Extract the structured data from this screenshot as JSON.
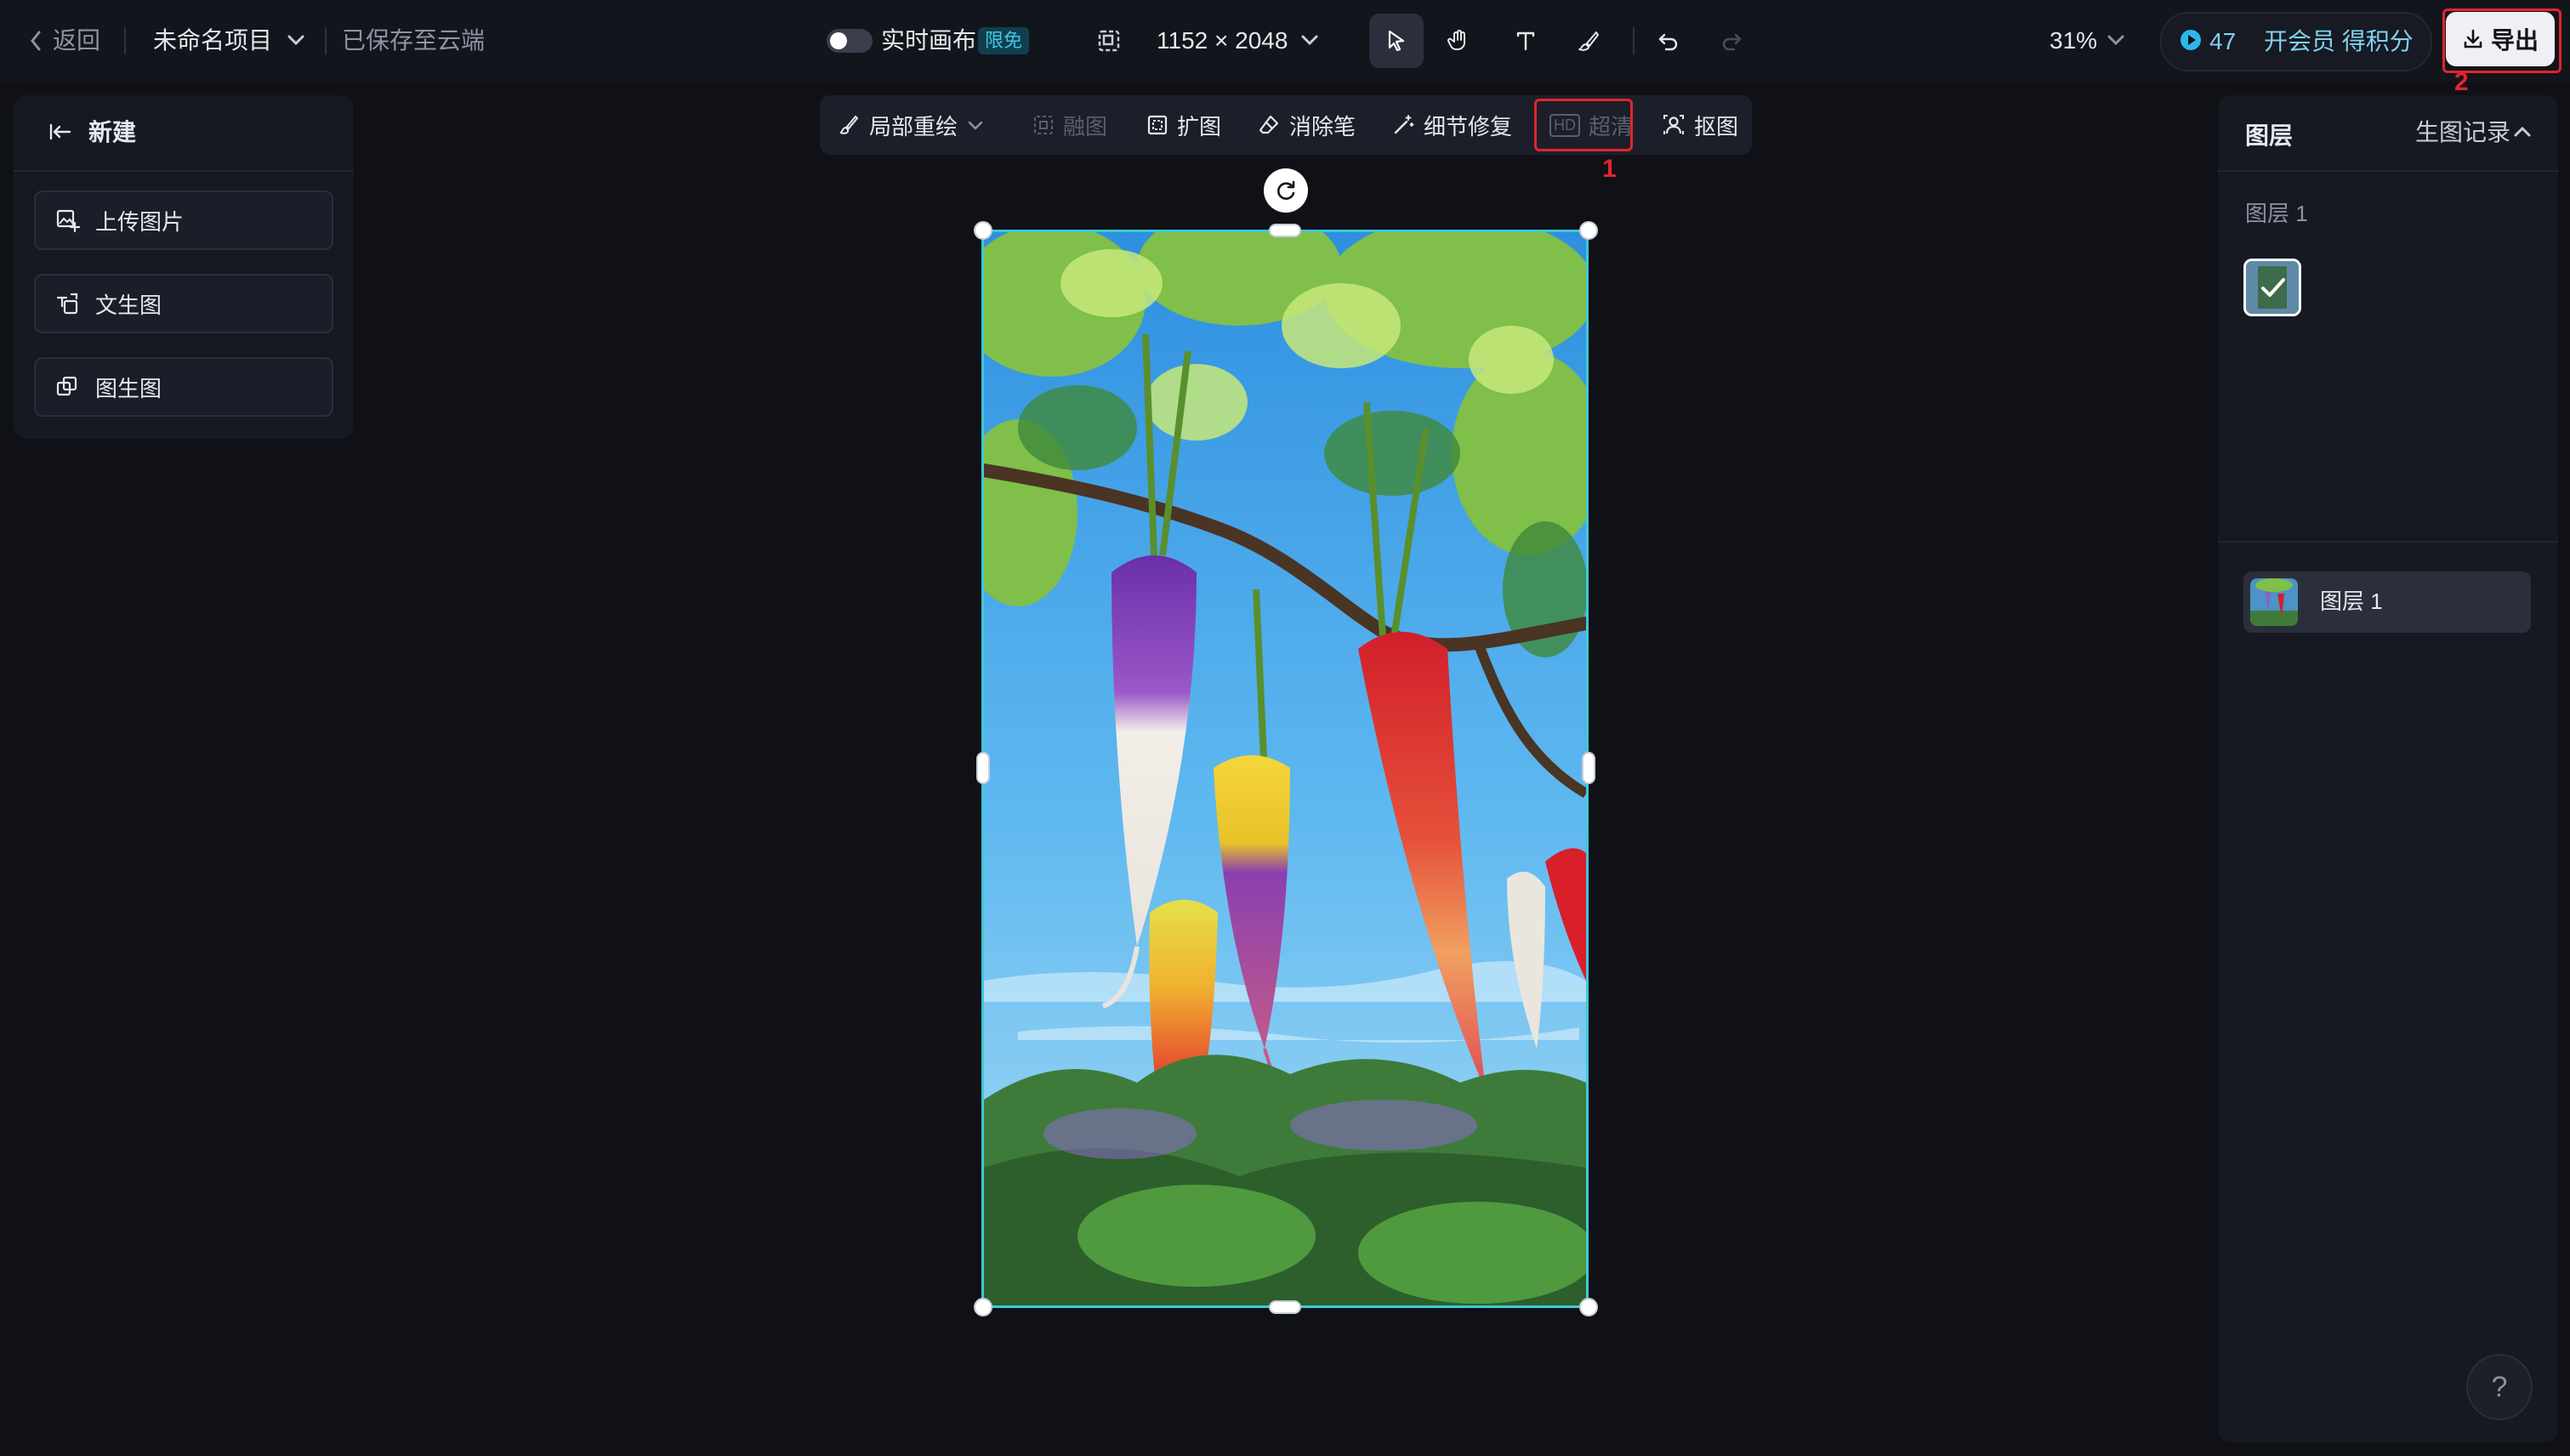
{
  "topbar": {
    "back_label": "返回",
    "project_name": "未命名项目",
    "save_status": "已保存至云端",
    "realtime_label": "实时画布",
    "free_badge": "限免",
    "canvas_size": "1152 × 2048",
    "zoom": "31%",
    "credits": "47",
    "vip_label": "开会员 得积分",
    "export_label": "导出"
  },
  "left_panel": {
    "new_label": "新建",
    "items": [
      {
        "label": "上传图片",
        "icon": "upload-image-icon"
      },
      {
        "label": "文生图",
        "icon": "text-to-image-icon"
      },
      {
        "label": "图生图",
        "icon": "image-to-image-icon"
      }
    ]
  },
  "float_toolbar": {
    "items": [
      {
        "label": "局部重绘",
        "icon": "inpaint-brush-icon",
        "has_dropdown": true,
        "enabled": true
      },
      {
        "label": "融图",
        "icon": "blend-icon",
        "enabled": false
      },
      {
        "label": "扩图",
        "icon": "expand-icon",
        "enabled": true
      },
      {
        "label": "消除笔",
        "icon": "eraser-icon",
        "enabled": true
      },
      {
        "label": "细节修复",
        "icon": "magic-wand-icon",
        "enabled": true
      },
      {
        "label": "超清",
        "icon_text": "HD",
        "enabled": false
      },
      {
        "label": "抠图",
        "icon": "cutout-icon",
        "enabled": true
      }
    ]
  },
  "annotations": {
    "marker_1": "1",
    "marker_2": "2"
  },
  "right_panel": {
    "title": "图层",
    "history_label": "生图记录",
    "layer_group_label": "图层 1",
    "layer_row_label": "图层 1"
  },
  "help": {
    "label": "?"
  },
  "colors": {
    "background": "#0f1116",
    "accent_cyan": "#3fc9d8",
    "annotation_red": "#e2242d",
    "vip_blue": "#7fd3f0"
  }
}
